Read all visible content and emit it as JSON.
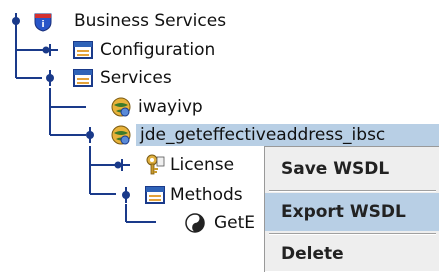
{
  "tree": {
    "nodes": [
      {
        "label": "Business Services",
        "icon": "iway-shield-icon"
      },
      {
        "label": "Configuration",
        "icon": "window-icon"
      },
      {
        "label": "Services",
        "icon": "window-icon"
      },
      {
        "label": "iwayivp",
        "icon": "service-globe-icon"
      },
      {
        "label": "jde_geteffectiveaddress_ibsc",
        "icon": "service-globe-icon"
      },
      {
        "label": "License",
        "icon": "key-icon"
      },
      {
        "label": "Methods",
        "icon": "window-icon"
      },
      {
        "label": "GetE",
        "icon": "method-ball-icon"
      }
    ]
  },
  "context_menu": {
    "items": [
      {
        "label": "Save WSDL"
      },
      {
        "label": "Export WSDL"
      },
      {
        "label": "Delete"
      }
    ],
    "highlighted": "Export WSDL"
  },
  "colors": {
    "selection": "#b8cfe5",
    "menu_bg": "#eeeeee",
    "line": "#1a3a8a"
  }
}
